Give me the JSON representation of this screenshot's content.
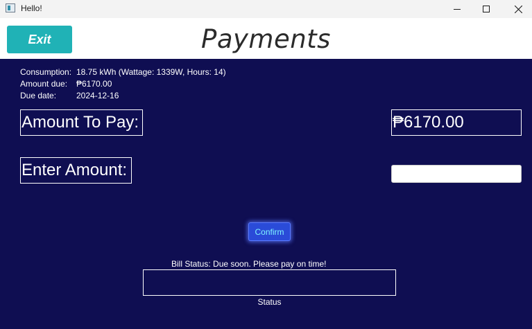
{
  "window": {
    "title": "Hello!"
  },
  "header": {
    "exit_label": "Exit",
    "title": "Payments"
  },
  "info": {
    "consumption_label": "Consumption:",
    "consumption_value": "18.75 kWh (Wattage: 1339W, Hours: 14)",
    "amount_due_label": "Amount due:",
    "amount_due_value": "₱6170.00",
    "due_date_label": "Due date:",
    "due_date_value": "2024-12-16"
  },
  "payment": {
    "amount_to_pay_label": "Amount To Pay:",
    "amount_to_pay_value": "₱6170.00",
    "enter_amount_label": "Enter Amount:",
    "enter_amount_value": "",
    "confirm_label": "Confirm"
  },
  "status": {
    "bill_status_text": "Bill Status:  Due soon. Please pay on time!",
    "status_box_value": "",
    "status_label": "Status"
  },
  "colors": {
    "background": "#0f0e52",
    "exit_button": "#20b2b6",
    "confirm_button": "#2a4bd8"
  }
}
